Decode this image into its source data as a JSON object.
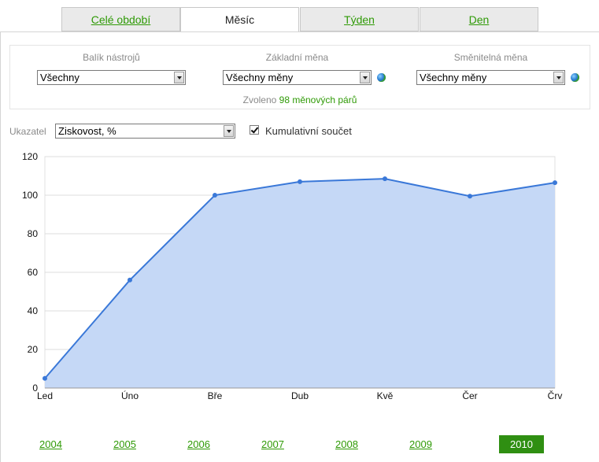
{
  "tabs": [
    {
      "label": "Celé období",
      "active": false
    },
    {
      "label": "Měsíc",
      "active": true
    },
    {
      "label": "Týden",
      "active": false
    },
    {
      "label": "Den",
      "active": false
    }
  ],
  "settings": {
    "toolset": {
      "label": "Balík nástrojů",
      "value": "Všechny"
    },
    "base_currency": {
      "label": "Základní měna",
      "value": "Všechny měny"
    },
    "quote_currency": {
      "label": "Směnitelná měna",
      "value": "Všechny měny"
    },
    "selected_prefix": "Zvoleno",
    "selected_count": "98 měnových párů"
  },
  "indicator": {
    "label": "Ukazatel",
    "value": "Ziskovost, %",
    "cumulative_label": "Kumulativní součet",
    "cumulative_checked": true
  },
  "colors": {
    "accent": "#2f9a06",
    "line": "#3a78d8",
    "area": "#c5d8f6"
  },
  "chart_data": {
    "type": "area",
    "categories": [
      "Led",
      "Úno",
      "Bře",
      "Dub",
      "Kvě",
      "Čer",
      "Črv"
    ],
    "values": [
      5,
      56,
      100,
      107,
      108.5,
      99.5,
      106.5
    ],
    "yticks": [
      0,
      20,
      40,
      60,
      80,
      100,
      120
    ],
    "ylim": [
      0,
      120
    ],
    "grid": true
  },
  "years": [
    {
      "label": "2004",
      "active": false
    },
    {
      "label": "2005",
      "active": false
    },
    {
      "label": "2006",
      "active": false
    },
    {
      "label": "2007",
      "active": false
    },
    {
      "label": "2008",
      "active": false
    },
    {
      "label": "2009",
      "active": false
    },
    {
      "label": "2010",
      "active": true
    }
  ]
}
